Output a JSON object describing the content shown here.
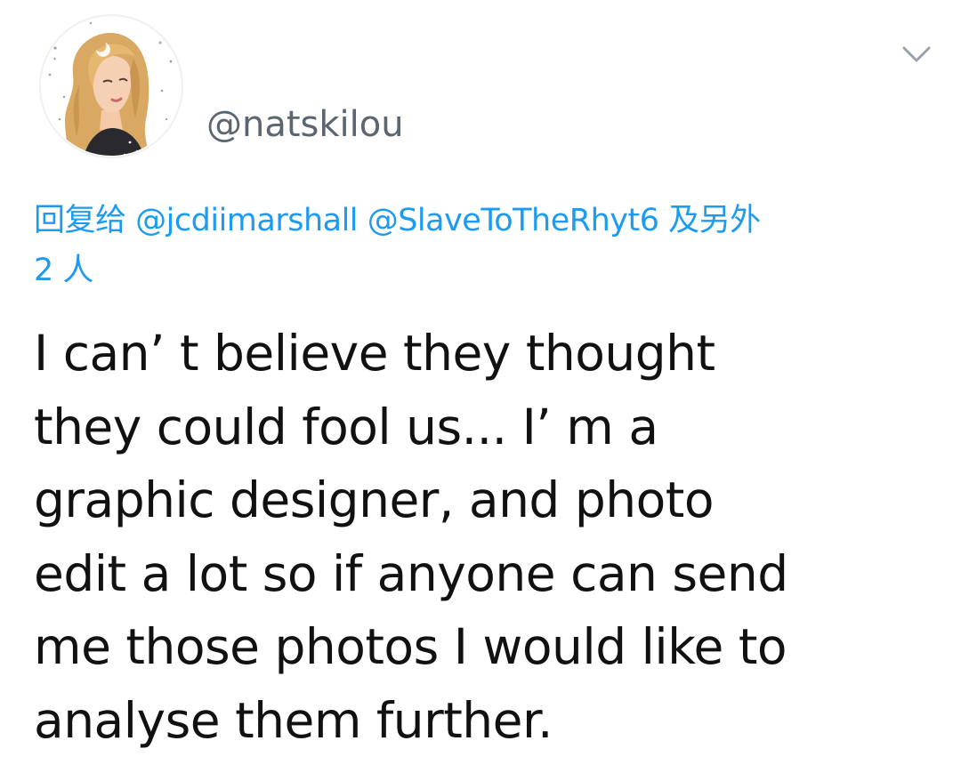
{
  "tweet": {
    "avatar": {
      "icon": "avatar-illustration-blonde-woman-moon"
    },
    "handle": "@natskilou",
    "menu": {
      "icon": "chevron-down-icon"
    },
    "reply": {
      "prefix": "回复给",
      "mentions": [
        "@jcdiimarshall",
        "@SlaveToTheRhyt6"
      ],
      "suffix_line1": "及另外",
      "suffix_line2": "2 人"
    },
    "text_lines": [
      "I can’ t believe they thought",
      "they could fool us... I’ m a",
      "graphic designer, and photo",
      "edit a lot so if anyone can send",
      "me those photos I would like to",
      "analyse them further."
    ],
    "colors": {
      "link": "#1d9bf0",
      "handle": "#5b6670",
      "text": "#111111",
      "background": "#ffffff"
    }
  }
}
